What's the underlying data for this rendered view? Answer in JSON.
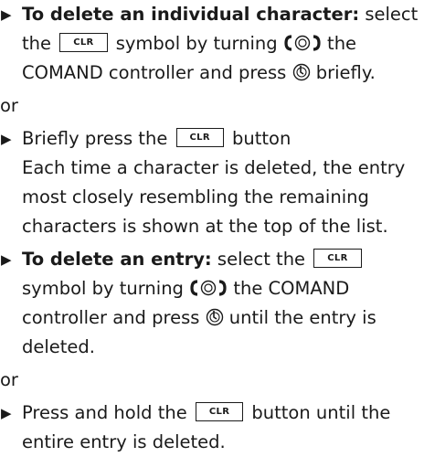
{
  "instructions": {
    "item1": {
      "label": "To delete an individual character:",
      "t1": " select the ",
      "key": "CLR",
      "t2": " symbol by turning ",
      "t3": " the COMAND controller and press ",
      "t4": " briefly."
    },
    "or1": "or",
    "item2": {
      "t1": "Briefly press the ",
      "key": "CLR",
      "t2": " button",
      "t3": "Each time a character is deleted, the entry most closely resembling the remaining characters is shown at the top of the list."
    },
    "item3": {
      "label": "To delete an entry:",
      "t1": " select the ",
      "key": "CLR",
      "t2": " symbol by turning ",
      "t3": " the COMAND controller and press ",
      "t4": " until the entry is deleted."
    },
    "or2": "or",
    "item4": {
      "t1": "Press and hold the ",
      "key": "CLR",
      "t2": " button until the entire entry is deleted."
    }
  },
  "icons": [
    "bullet-triangle-icon",
    "rotate-controller-icon",
    "press-controller-icon"
  ]
}
